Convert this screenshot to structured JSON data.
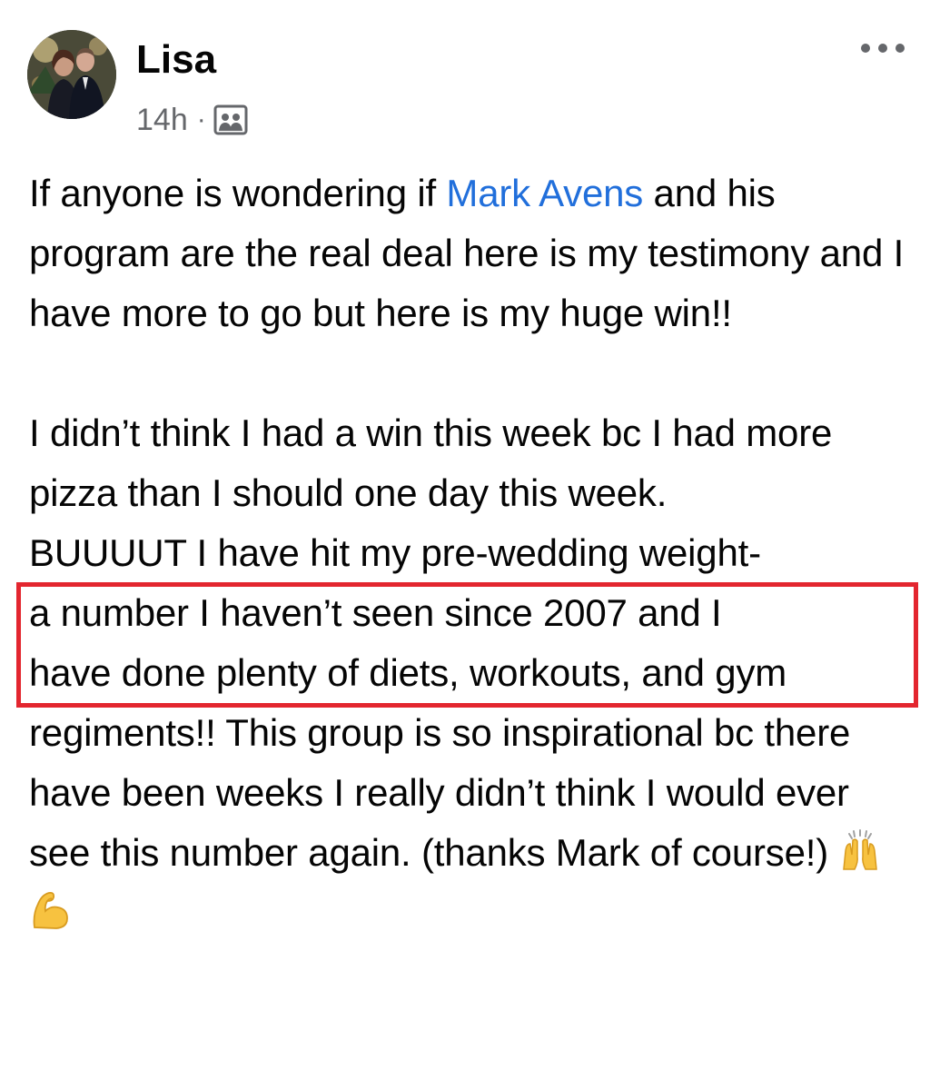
{
  "post": {
    "author": {
      "name": "Lisa",
      "avatar_icon": "profile-photo"
    },
    "timestamp": "14h",
    "separator": "·",
    "audience_icon": "group-members-icon",
    "more_icon": "more-options-icon",
    "body": {
      "line1_prefix": "If anyone is wondering if ",
      "mention": "Mark Avens",
      "line1_suffix": " and his program are the real deal here is my testimony and I have more to go but here is my huge win!!",
      "para2_start": "I didn’t think I had a win this week bc I had more pizza than I should one day this week.",
      "highlight_line1": "BUUUUT I have hit my pre-wedding weight-",
      "highlight_line2": "a number I haven’t seen since 2007 and I",
      "para2_end": "have done plenty of diets, workouts, and gym regiments!!  This group is so inspirational bc there have been weeks I really didn’t think I would ever see this number again. (thanks Mark of course!)",
      "emojis": [
        "raising-hands-emoji",
        "flexed-biceps-emoji"
      ]
    },
    "highlight_color": "#e3262f",
    "mention_color": "#216fdb"
  }
}
